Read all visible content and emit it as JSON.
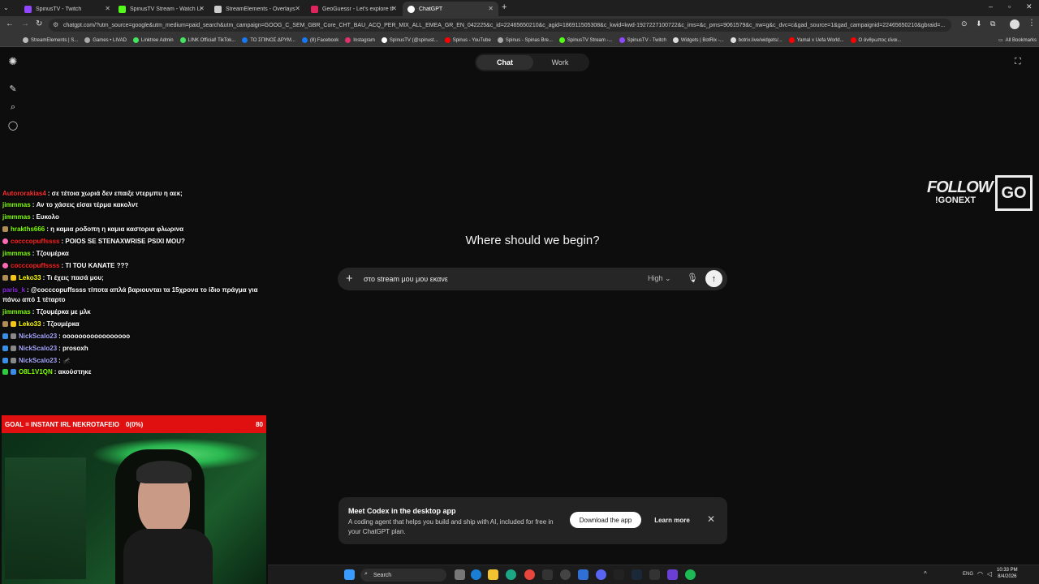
{
  "browser": {
    "tabs": [
      {
        "label": "SpinusTV - Twitch",
        "color": "#9146ff",
        "active": false
      },
      {
        "label": "SpinusTV Stream - Watch Live -",
        "color": "#53fc18",
        "active": false
      },
      {
        "label": "StreamElements - Overlays",
        "color": "#cccccc",
        "active": false
      },
      {
        "label": "GeoGuessr - Let's explore the w",
        "color": "#e0245e",
        "active": false
      },
      {
        "label": "ChatGPT",
        "color": "#ffffff",
        "active": true
      }
    ],
    "url": "chatgpt.com/?utm_source=google&utm_medium=paid_search&utm_campaign=GOOG_C_SEM_GBR_Core_CHT_BAU_ACQ_PER_MIX_ALL_EMEA_GR_EN_042225&c_id=22465650210&c_agid=186911505308&c_kwid=kwd-1927227100722&c_ims=&c_pms=9061579&c_nw=g&c_dvc=c&gad_source=1&gad_campaignid=22465650210&gbraid=...",
    "bookmarks": [
      {
        "label": "StreamElements | S...",
        "color": "#bbbbbb"
      },
      {
        "label": "Games • LIVAD",
        "color": "#aaaaaa"
      },
      {
        "label": "Linktree Admin",
        "color": "#43e55e"
      },
      {
        "label": "LINK Official! TikTok...",
        "color": "#43e55e"
      },
      {
        "label": "ΤΟ ΣΠΙΝΟΣ ΔΡΥΜ...",
        "color": "#1877f2"
      },
      {
        "label": "(8) Facebook",
        "color": "#1877f2"
      },
      {
        "label": "Instagram",
        "color": "#e1306c"
      },
      {
        "label": "SpinusTV (@spinust...",
        "color": "#ffffff"
      },
      {
        "label": "Spinus - YouTube",
        "color": "#ff0000"
      },
      {
        "label": "Spinus - Spinas Bre...",
        "color": "#aaaaaa"
      },
      {
        "label": "SpinusTV Stream -...",
        "color": "#53fc18"
      },
      {
        "label": "SpinusTV - Twitch",
        "color": "#9146ff"
      },
      {
        "label": "Widgets | BotRix -...",
        "color": "#dddddd"
      },
      {
        "label": "botrix.live/widgets/...",
        "color": "#dddddd"
      },
      {
        "label": "Yamal x Uefa World...",
        "color": "#ff0000"
      },
      {
        "label": "Ο άνθρωπος είναι...",
        "color": "#ff0000"
      }
    ],
    "all_bookmarks": "All Bookmarks"
  },
  "chatgpt": {
    "tab_chat": "Chat",
    "tab_work": "Work",
    "headline": "Where should we begin?",
    "input_value": "στο stream μου μου εκανε",
    "model": "High",
    "banner_title": "Meet Codex in the desktop app",
    "banner_desc": "A coding agent that helps you build and ship with AI, included for free in your ChatGPT plan.",
    "download_label": "Download the app",
    "learn_more_label": "Learn more"
  },
  "chat": [
    {
      "user": "Autororakias4",
      "color": "#ff3030",
      "text": ": σε τέτοια χωριά δεν επαιξε ντερμπυ η αεκ;"
    },
    {
      "user": "jimmmas",
      "color": "#7fff00",
      "text": ": Αν το χάσεις είσαι τέρμα κακολντ"
    },
    {
      "user": "jimmmas",
      "color": "#7fff00",
      "text": ": Ευκολο"
    },
    {
      "user": "hrakths666",
      "color": "#7fff00",
      "text": ": η καμια ροδοπη η καμια καστορια φλωρινα"
    },
    {
      "user": "cocccopuffssss",
      "color": "#ff2020",
      "text": ": POIOS SE STENAXWRISE PSIXI MOU?"
    },
    {
      "user": "jimmmas",
      "color": "#7fff00",
      "text": ": Τζουμέρκα"
    },
    {
      "user": "cocccopuffssss",
      "color": "#ff2020",
      "text": ": TI TOU KANATE ???"
    },
    {
      "user": "",
      "color": "#ffffff",
      "text": "🍺 Τι έχεις πασά μου;"
    },
    {
      "user": "Leko33",
      "color": "#ffff00",
      "text": ": Τι έχεις πασά μου;"
    },
    {
      "user": "paris_k",
      "color": "#8a2be2",
      "text": ": @cocccopuffssss τίποτα απλά βαριουνται τα 15χρονα το ίδιο πράγμα για"
    },
    {
      "user": "",
      "color": "#ffffff",
      "text": "πάνω από 1 τέταρτο"
    },
    {
      "user": "jimmmas",
      "color": "#7fff00",
      "text": ": Τζουμέρκα με μλκ"
    },
    {
      "user": "Leko33",
      "color": "#ffff00",
      "text": ": Τζουμέρκα"
    },
    {
      "user": "NickScalo23",
      "color": "#a8a8ff",
      "text": ": οοοοοοοοοοοοοοοοο"
    },
    {
      "user": "NickScalo23",
      "color": "#a8a8ff",
      "text": ": prosoxh"
    },
    {
      "user": "NickScalo23",
      "color": "#a8a8ff",
      "text": ": 🦟"
    },
    {
      "user": "O8L1V1QN",
      "color": "#7fff00",
      "text": ": ακούστηκε"
    }
  ],
  "goal": {
    "label": "GOAL = INSTANT IRL NEKROTAFEIO",
    "value": "0(0%)",
    "target": "80"
  },
  "follow": {
    "line1": "FOLLOW",
    "line2": "!GONEXT",
    "mark": "GO"
  },
  "taskbar": {
    "search": "Search",
    "lang": "ENG",
    "time": "10:33 PM",
    "date": "8/4/2026"
  }
}
